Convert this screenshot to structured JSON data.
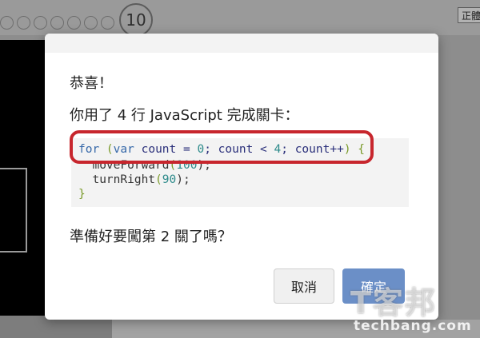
{
  "background": {
    "current_level": "10",
    "corner_button_label": "正體"
  },
  "dialog": {
    "title": "恭喜！",
    "message": "你用了 4 行 JavaScript 完成關卡：",
    "code": {
      "line1": {
        "kw": "for",
        "open": " (",
        "kw2": "var",
        "rest1": " count = ",
        "num1": "0",
        "rest2": "; count < ",
        "num2": "4",
        "rest3": "; count++",
        "close": ")",
        "brace": " {"
      },
      "line2": {
        "fn": "  moveForward",
        "open": "(",
        "num": "100",
        "close": ");"
      },
      "line3": {
        "fn": "  turnRight",
        "open": "(",
        "num": "90",
        "close": ");"
      },
      "line4": "}"
    },
    "question": "準備好要闖第 2 關了嗎？",
    "cancel_label": "取消",
    "confirm_label": "確定"
  },
  "watermark": {
    "brand": "T客邦",
    "site": "techbang.com"
  }
}
